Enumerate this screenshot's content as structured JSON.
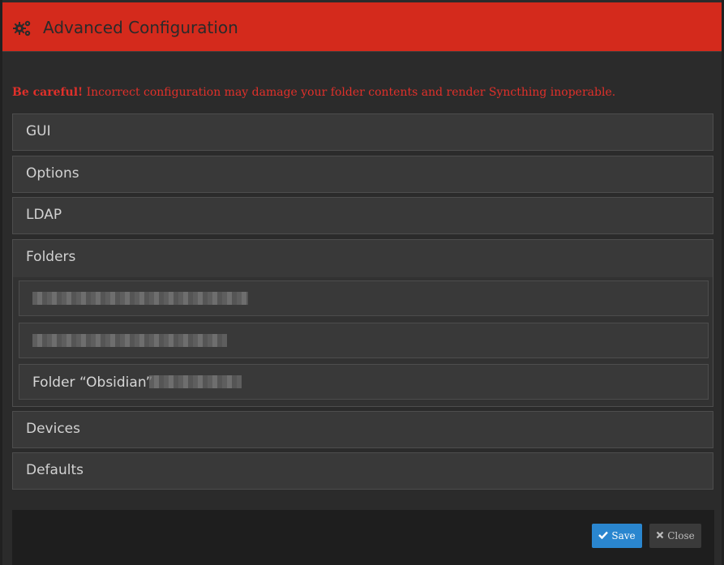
{
  "header": {
    "title": "Advanced Configuration",
    "icon": "gears-icon",
    "color": "#d42a1c"
  },
  "warning": {
    "strong": "Be careful!",
    "text": " Incorrect configuration may damage your folder contents and render Syncthing inoperable."
  },
  "sections": {
    "gui": "GUI",
    "options": "Options",
    "ldap": "LDAP",
    "folders": "Folders",
    "devices": "Devices",
    "defaults": "Defaults"
  },
  "folders": {
    "items": [
      {
        "label": "",
        "redacted": true
      },
      {
        "label": "",
        "redacted": true
      },
      {
        "label": "Folder “Obsidian”",
        "redacted_suffix": true
      }
    ]
  },
  "footer": {
    "save_label": "Save",
    "close_label": "Close"
  }
}
